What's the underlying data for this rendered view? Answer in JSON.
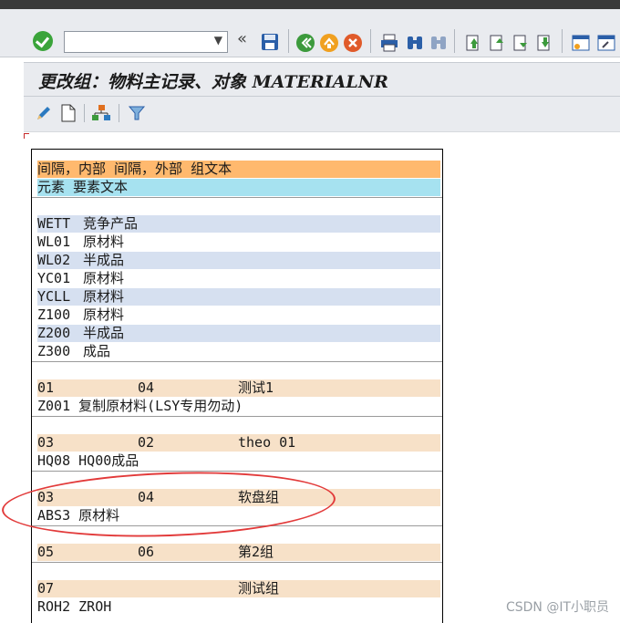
{
  "command": {
    "value": ""
  },
  "screen": {
    "title": "更改组：物料主记录、对象 MATERIALNR"
  },
  "table": {
    "header": {
      "line1": "间隔，内部 间隔，外部 组文本",
      "line2": "元素 要素文本"
    },
    "elements": [
      {
        "code": "WETT",
        "text": "竞争产品"
      },
      {
        "code": "WL01",
        "text": "原材料"
      },
      {
        "code": "WL02",
        "text": "半成品"
      },
      {
        "code": "YC01",
        "text": "原材料"
      },
      {
        "code": "YCLL",
        "text": "原材料"
      },
      {
        "code": "Z100",
        "text": "原材料"
      },
      {
        "code": "Z200",
        "text": "半成品"
      },
      {
        "code": "Z300",
        "text": "成品"
      }
    ],
    "groups": [
      {
        "internal": "01",
        "external": "04",
        "name": "测试1",
        "element": "Z001 复制原材料(LSY专用勿动)"
      },
      {
        "internal": "03",
        "external": "02",
        "name": "theo 01",
        "element": "HQ08 HQ00成品"
      },
      {
        "internal": "03",
        "external": "04",
        "name": "软盘组",
        "element": "ABS3 原材料"
      },
      {
        "internal": "05",
        "external": "06",
        "name": "第2组",
        "element": ""
      },
      {
        "internal": "07",
        "external": "",
        "name": "测试组",
        "element": "ROH2 ZROH"
      }
    ]
  },
  "colors": {
    "header_row_1": "#ffb96e",
    "header_row_2": "#a6e2f0",
    "element_stripe": "#d6e0f0",
    "group_row": "#f7e1c8",
    "highlight_circle": "#e23a3a"
  },
  "watermark": "CSDN @IT小职员"
}
